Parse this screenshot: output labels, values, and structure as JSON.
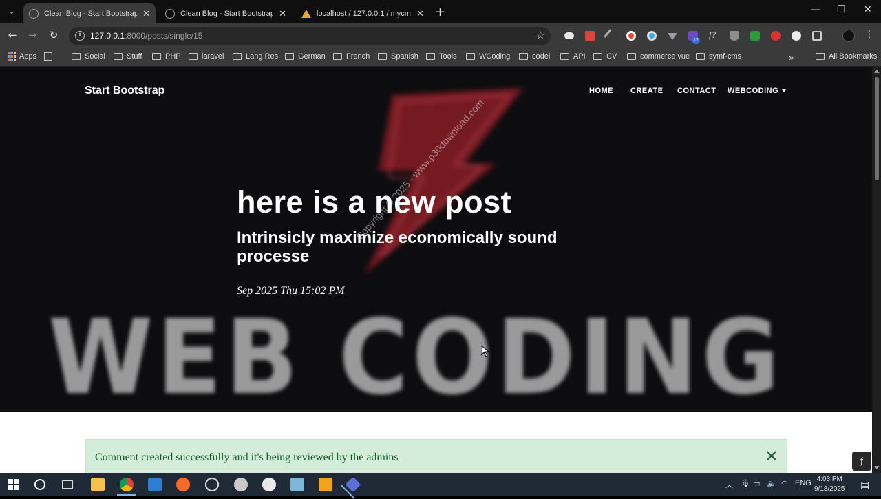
{
  "browser": {
    "tabs": [
      {
        "title": "Clean Blog - Start Bootstrap Th",
        "active": true
      },
      {
        "title": "Clean Blog - Start Bootstrap Th",
        "active": false
      },
      {
        "title": "localhost / 127.0.0.1 / mycms /",
        "active": false
      }
    ],
    "url_host": "127.0.0.1",
    "url_path": ":8000/posts/single/15",
    "bookmarks": [
      "Apps",
      "Social",
      "Stuff",
      "PHP",
      "laravel",
      "Lang Res",
      "German",
      "French",
      "Spanish",
      "Tools",
      "WCoding",
      "codei",
      "API",
      "CV",
      "commerce vue",
      "symf-cms"
    ],
    "all_bookmarks": "All Bookmarks",
    "extension_badge": "12"
  },
  "site": {
    "brand": "Start Bootstrap",
    "nav": [
      "HOME",
      "CREATE",
      "CONTACT",
      "WEBCODING"
    ]
  },
  "post": {
    "title": "here is a new post",
    "subtitle": "Intrinsicly maximize economically sound processe",
    "meta": "Sep 2025 Thu 15:02 PM"
  },
  "hero_image": {
    "word": "WEB CODING",
    "watermark": "Copyright © 2025 - www.p30download.com"
  },
  "alert": {
    "message": "Comment created successfully and it's being reviewed by the admins",
    "close": "✕"
  },
  "taskbar": {
    "language": "ENG",
    "time": "4:03 PM",
    "date": "9/18/2025"
  }
}
